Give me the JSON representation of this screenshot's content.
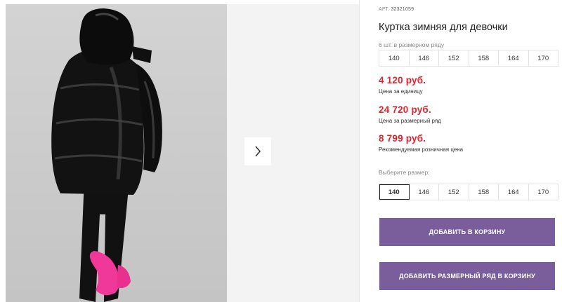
{
  "gallery": {
    "next_icon": "chevron-right-icon"
  },
  "product": {
    "sku_label": "АРТ.",
    "sku_value": "32321059",
    "title": "Куртка зимняя для девочки",
    "pack_hint": "6 шт. в размерном ряду",
    "pack_sizes": [
      "140",
      "146",
      "152",
      "158",
      "164",
      "170"
    ],
    "prices": {
      "unit_value": "4 120 руб.",
      "unit_label": "Цена за единицу",
      "pack_value": "24 720 руб.",
      "pack_label": "Цена за размерный ряд",
      "retail_value": "8 799 руб.",
      "retail_label": "Рекомендуемая розничная цена"
    },
    "select_hint": "Выберите размер:",
    "select_sizes": [
      "140",
      "146",
      "152",
      "158",
      "164",
      "170"
    ],
    "selected_size": "140",
    "add_to_cart_label": "ДОБАВИТЬ В КОРЗИНУ",
    "add_pack_label": "ДОБАВИТЬ РАЗМЕРНЫЙ РЯД В КОРЗИНУ"
  },
  "colors": {
    "price": "#e1232d",
    "button": "#7a5e9b"
  }
}
